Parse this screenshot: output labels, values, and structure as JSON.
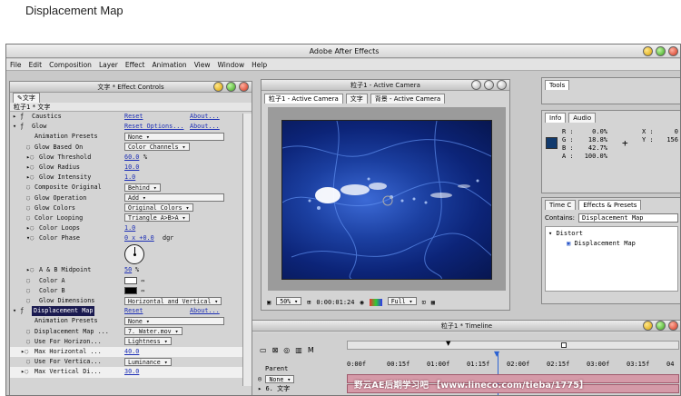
{
  "caption": "Displacement Map",
  "app": {
    "title": "Adobe After Effects"
  },
  "menu": [
    "File",
    "Edit",
    "Composition",
    "Layer",
    "Effect",
    "Animation",
    "View",
    "Window",
    "Help"
  ],
  "effect_controls": {
    "title": "文字 * Effect Controls",
    "tab": "文字",
    "subtitle": "粒子1 * 文字",
    "rows": [
      {
        "name": "Caustics",
        "value": "Reset",
        "about": "About..."
      },
      {
        "name": "Glow",
        "value": "Reset Options...",
        "about": "About..."
      },
      {
        "name": "Animation Presets",
        "dropdown": "None"
      },
      {
        "name": "Glow Based On",
        "dropdown": "Color Channels"
      },
      {
        "name": "Glow Threshold",
        "value": "60.0",
        "unit": "%"
      },
      {
        "name": "Glow Radius",
        "value": "10.0"
      },
      {
        "name": "Glow Intensity",
        "value": "1.0"
      },
      {
        "name": "Composite Original",
        "dropdown": "Behind"
      },
      {
        "name": "Glow Operation",
        "dropdown": "Add"
      },
      {
        "name": "Glow Colors",
        "dropdown": "Original Colors"
      },
      {
        "name": "Color Looping",
        "dropdown": "Triangle A>B>A"
      },
      {
        "name": "Color Loops",
        "value": "1.0"
      },
      {
        "name": "Color Phase",
        "value": "0 x +0.0",
        "unit": "dgr"
      },
      {
        "name": "A & B Midpoint",
        "value": "50",
        "unit": "%"
      },
      {
        "name": "Color A"
      },
      {
        "name": "Color B"
      },
      {
        "name": "Glow Dimensions",
        "dropdown": "Horizontal and Vertical"
      },
      {
        "name": "Displacement Map",
        "value": "Reset",
        "about": "About..."
      },
      {
        "name": "Animation Presets",
        "dropdown": "None"
      },
      {
        "name": "Displacement Map ...",
        "dropdown": "7. Water.mov"
      },
      {
        "name": "Use For Horizon...",
        "dropdown": "Lightness"
      },
      {
        "name": "Max Horizontal ...",
        "value": "40.0"
      },
      {
        "name": "Use For Vertica...",
        "dropdown": "Luminance"
      },
      {
        "name": "Max Vertical Di...",
        "value": "30.0"
      }
    ]
  },
  "camera": {
    "title": "粒子1 - Active Camera",
    "tabs": [
      "粒子1 - Active Camera",
      "文字",
      "背景 - Active Camera"
    ],
    "zoom": "50%",
    "timecode": "0:00:01:24",
    "resolution": "Full"
  },
  "tools": {
    "title": "Tools"
  },
  "info": {
    "tabs": [
      "Info",
      "Audio"
    ],
    "R": "0.0%",
    "G": "18.8%",
    "B": "42.7%",
    "A": "100.0%",
    "X": "0",
    "Y": "156",
    "swatch": "#123a6d"
  },
  "effects_presets": {
    "tabs": [
      "Time C",
      "Effects & Presets"
    ],
    "contains_label": "Contains:",
    "contains_value": "Displacement Map",
    "category": "Distort",
    "item": "Displacement Map"
  },
  "timeline": {
    "title": "粒子1 * Timeline",
    "column": "Parent",
    "rows": [
      {
        "parent": "None",
        "layer": "6. 文字"
      }
    ],
    "ticks": [
      "0:00f",
      "00:15f",
      "01:00f",
      "01:15f",
      "02:00f",
      "02:15f",
      "03:00f",
      "03:15f",
      "04"
    ]
  },
  "watermark": "野云AE后期学习吧 【www.lineco.com/tieba/1775】"
}
